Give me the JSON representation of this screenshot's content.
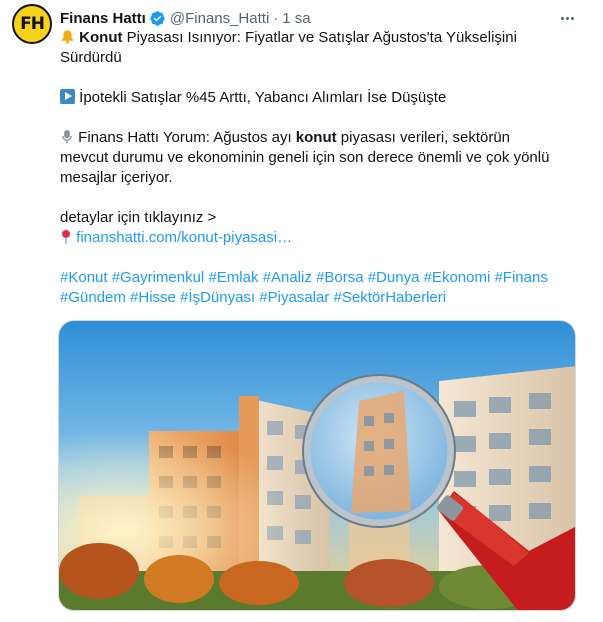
{
  "author": {
    "name": "Finans Hattı",
    "handle": "@Finans_Hatti",
    "separator": "·",
    "time": "1 sa",
    "avatar_text": "FH"
  },
  "tweet": {
    "line1_bold": "Konut",
    "line1_rest": " Piyasası Isınıyor: Fiyatlar ve Satışlar Ağustos'ta Yükselişini",
    "line2": "Sürdürdü",
    "line3": " İpotekli Satışlar %45 Arttı, Yabancı Alımları İse Düşüşte",
    "line4_pre": " Finans Hattı Yorum: Ağustos ayı ",
    "line4_bold": "konut",
    "line4_post": " piyasası verileri, sektörün",
    "line5": "mevcut durumu ve ekonominin geneli için son derece önemli ve çok yönlü",
    "line6": "mesajlar içeriyor.",
    "line7": "detaylar için tıklayınız >",
    "link": "finanshatti.com/konut-piyasasi…"
  },
  "hashtags_row1": [
    "#Konut",
    "#Gayrimenkul",
    "#Emlak",
    "#Analiz",
    "#Borsa",
    "#Dunya",
    "#Ekonomi",
    "#Finans"
  ],
  "hashtags_row2": [
    "#Gündem",
    "#Hisse",
    "#İşDünyası",
    "#Piyasalar",
    "#SektörHaberleri"
  ],
  "icons": {
    "bell": "bell-icon",
    "play": "play-button-icon",
    "mic": "microphone-icon",
    "pin": "round-pushpin-icon",
    "verified": "verified-badge-icon",
    "more": "more-options-icon"
  },
  "colors": {
    "link": "#1d9bf0",
    "verified": "#1d9bf0",
    "secondary_text": "#536471",
    "avatar_bg": "#f7d21a"
  }
}
